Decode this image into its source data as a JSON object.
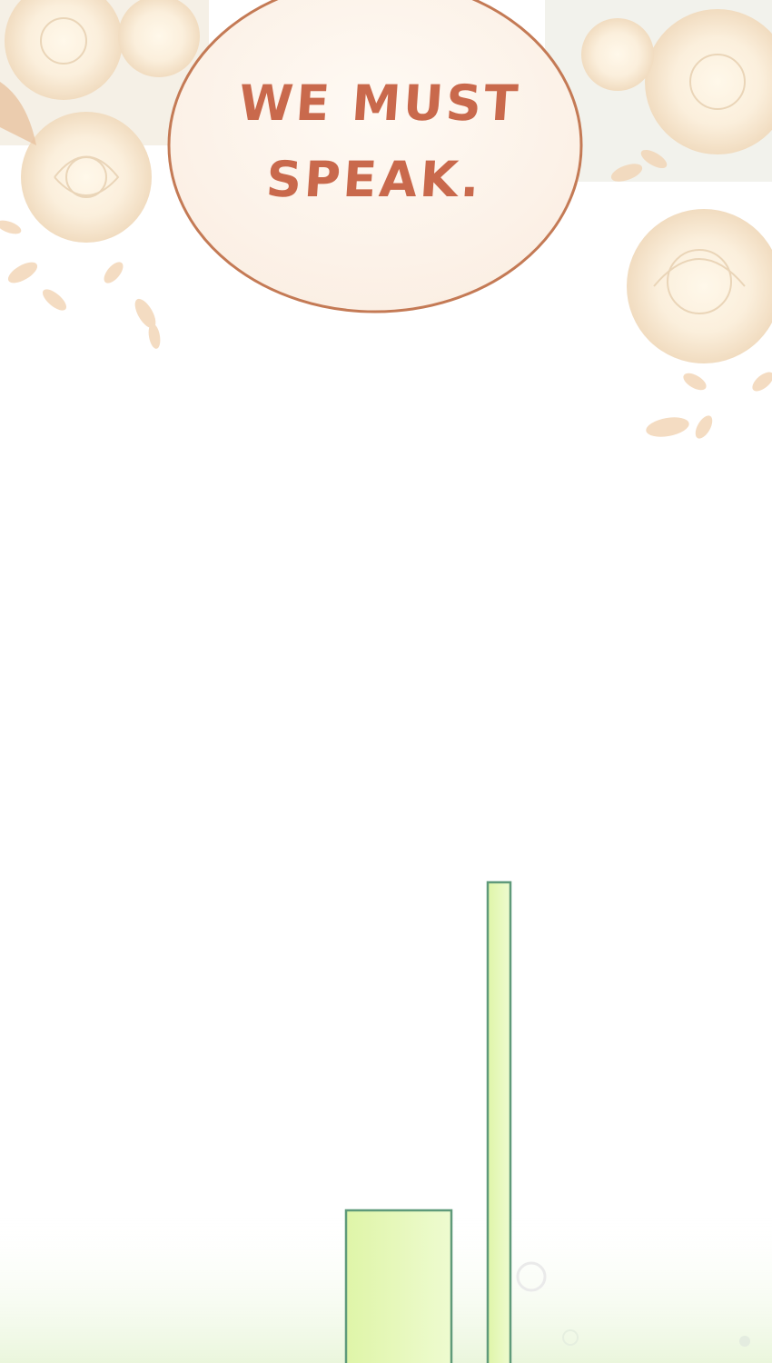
{
  "speech_bubble": {
    "text": "WE MUST\nSPEAK."
  },
  "colors": {
    "bubble_text": "#c9694c",
    "bubble_outline": "#c47a55",
    "bubble_fill": "#fdf6ef",
    "flowers": "#fbeedd",
    "leaves": "#f3d6b8",
    "pillar_fill": "#e3f8b4",
    "pillar_outline": "#5f9a7a",
    "mist": "#eef8e2"
  },
  "icons": [
    "white-rose-icon",
    "leaf-sprig-icon",
    "green-pillar-icon"
  ]
}
